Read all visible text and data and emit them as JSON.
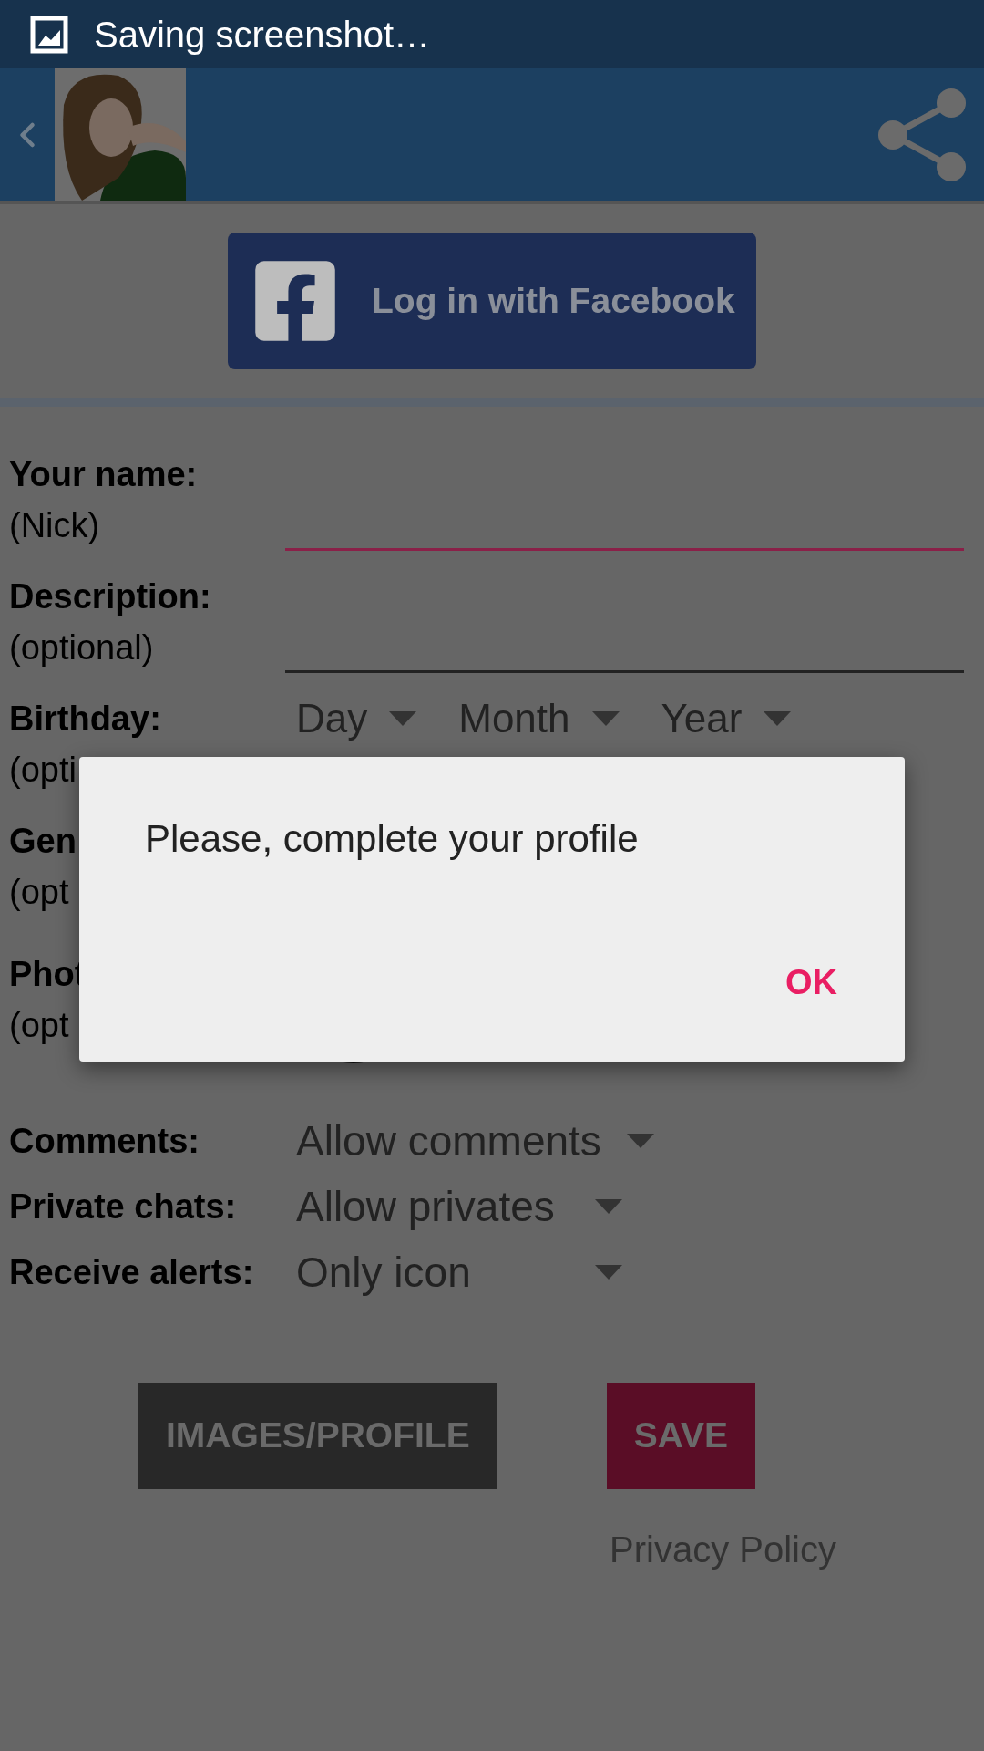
{
  "status_bar": {
    "text": "Saving screenshot…"
  },
  "facebook_button": {
    "label": "Log in with Facebook"
  },
  "fields": [
    {
      "kind": "text",
      "label": "Your name:",
      "hint": "(Nick)",
      "focused": true
    },
    {
      "kind": "text",
      "label": "Description:",
      "hint": "(optional)",
      "focused": false
    },
    {
      "kind": "dropdowns",
      "label": "Birthday:",
      "hint": "(opti",
      "options": [
        "Day",
        "Month",
        "Year"
      ]
    },
    {
      "kind": "covered",
      "label": "Gen",
      "hint": "(opt"
    },
    {
      "label": "Phot",
      "hint": "(opt"
    }
  ],
  "settings": [
    {
      "label": "Comments:",
      "value": "Allow comments"
    },
    {
      "label": "Private chats:",
      "value": "Allow privates"
    },
    {
      "label": "Receive alerts:",
      "value": "Only icon"
    }
  ],
  "buttons": [
    {
      "kind": "secondary",
      "label": "IMAGES/PROFILE"
    },
    {
      "kind": "primary",
      "label": "SAVE"
    }
  ],
  "privacy_link": "Privacy Policy",
  "dialog": {
    "message": "Please, complete your profile",
    "ok": "OK"
  }
}
